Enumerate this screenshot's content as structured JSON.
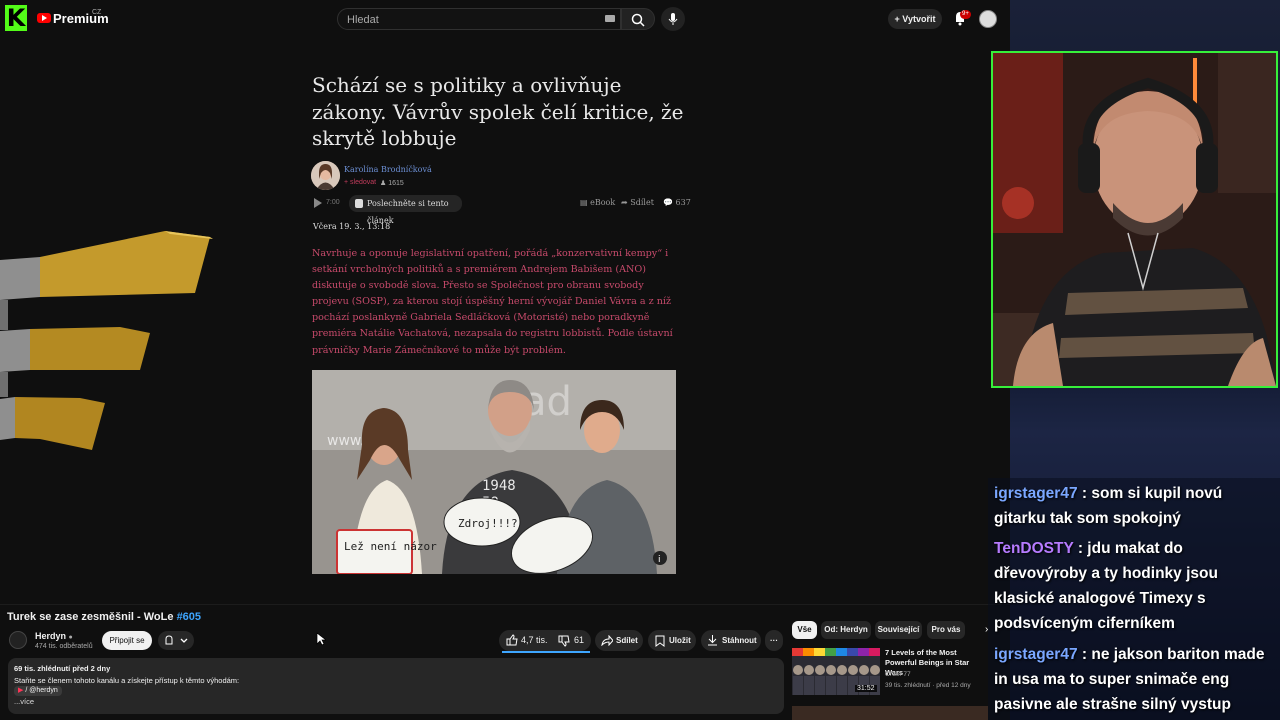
{
  "topbar": {
    "kick_logo": "K",
    "brand": "Premium",
    "brand_region": "CZ",
    "search_placeholder": "Hledat",
    "create_label": "Vytvořit",
    "notif_count": "9+"
  },
  "article": {
    "title": "Schází se s politiky a ovlivňuje zákony. Vávrův spolek čelí kritice, že skrytě lobbuje",
    "author": "Karolína Brodníčková",
    "follow_label": "+ sledovat",
    "followers": "1615",
    "duration": "7:00",
    "listen_label": "Poslechněte si tento článek",
    "ebook_label": "eBook",
    "share_label": "Sdílet",
    "comments": "637",
    "date": "Včera 19. 3., 13:18",
    "lead": "Navrhuje a oponuje legislativní opatření, pořádá „konzervativní kempy“ i setkání vrcholných politiků a s premiérem Andrejem Babišem (ANO) diskutuje o svobodě slova. Přesto se Společnost pro obranu svobody projevu (SOSP), za kterou stojí úspěšný herní vývojář Daniel Vávra a z níž pochází poslankyně Gabriela Sedláčková (Motoristé) nebo poradkyně premiéra Natálie Vachatová, nezapsala do registru lobbistů. Podle ústavní právničky Marie Zámečníkové to může být problém.",
    "photo_signs": [
      "Lež není názor",
      "Zdroj!!!?"
    ]
  },
  "video": {
    "title": "Turek se zase zesměšnil - WoLe ",
    "title_tag": "#605",
    "channel": "Herdyn",
    "subscribers": "474 tis. odběratelů",
    "join_label": "Připojit se",
    "likes": "4,7 tis.",
    "dislikes": "61",
    "share_label": "Sdílet",
    "save_label": "Uložit",
    "download_label": "Stáhnout",
    "desc_views": "69 tis. zhlédnutí  před 2 dny",
    "desc_line": "Staňte se členem tohoto kanálu a získejte přístup k těmto výhodám:",
    "desc_chip": "/ @herdyn",
    "desc_more": "...více"
  },
  "sidebar": {
    "chips": [
      "Vše",
      "Od: Herdyn",
      "Související",
      "Pro vás"
    ],
    "rec": {
      "title": "7 Levels of the Most Powerful Beings in Star Wars",
      "channel": "Order 77",
      "meta": "39 tis. zhlédnutí · před 12 dny",
      "duration": "31:52"
    }
  },
  "chat": [
    {
      "user": "igrstager47",
      "text": " : som si kupil novú gitarku tak som spokojný"
    },
    {
      "user": "TenDOSTY",
      "text": " : jdu makat do dřevovýroby a ty hodinky jsou klasické analogové Timexy s podsvíceným ciferníkem"
    },
    {
      "user": "igrstager47",
      "text": " : ne jakson bariton made in usa ma to super snimače eng pasivne ale strašne silný vystup"
    }
  ],
  "colors": {
    "kick_green": "#53fc18",
    "cam_border": "#37f03a",
    "lead_text": "#c74a6b",
    "link_blue": "#3ea6ff"
  }
}
